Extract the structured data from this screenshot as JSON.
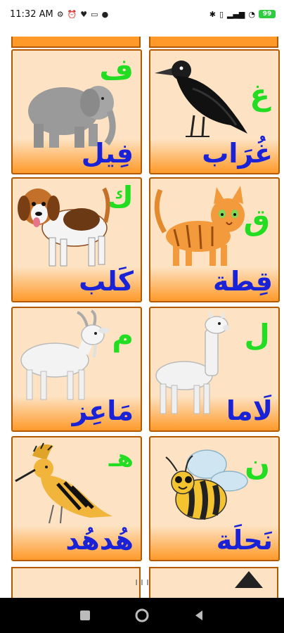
{
  "status_bar": {
    "time": "11:32 AM",
    "left_icons": [
      "network-icon",
      "alarm-icon",
      "heart-icon",
      "sim-icon",
      "chat-icon"
    ],
    "right_icons": [
      "bluetooth-icon",
      "vibrate-icon",
      "signal-icon",
      "wifi-icon"
    ],
    "battery": "99"
  },
  "cards": [
    {
      "letter": "ف",
      "word": "فِيل",
      "animal": "elephant"
    },
    {
      "letter": "غ",
      "word": "غُرَاب",
      "animal": "crow"
    },
    {
      "letter": "ك",
      "word": "كَلب",
      "animal": "dog"
    },
    {
      "letter": "ق",
      "word": "قِطة",
      "animal": "cat"
    },
    {
      "letter": "م",
      "word": "مَاعِز",
      "animal": "goat"
    },
    {
      "letter": "ل",
      "word": "لَاما",
      "animal": "llama"
    },
    {
      "letter": "هـ",
      "word": "هُدهُد",
      "animal": "hoopoe"
    },
    {
      "letter": "ن",
      "word": "نَحلَة",
      "animal": "bee"
    }
  ],
  "colors": {
    "letter": "#22dd22",
    "word": "#1a22d8",
    "card_top": "#fde3c3",
    "card_bottom": "#ff9a2a",
    "border": "#b35a00"
  },
  "nav": {
    "back_icon": "back-icon",
    "home_icon": "home-icon",
    "recents_icon": "recents-icon"
  }
}
